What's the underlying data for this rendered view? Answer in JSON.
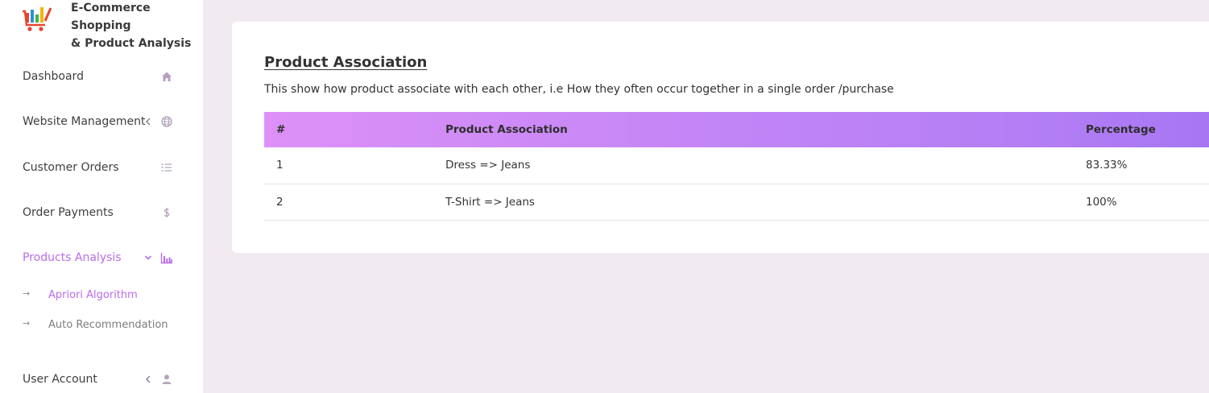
{
  "app": {
    "title": "E-Commerce Shopping\n& Product Analysis",
    "accent_color": "#b96bea"
  },
  "sidebar": {
    "items": [
      {
        "label": "Dashboard",
        "icon": "home-icon",
        "chevron": ""
      },
      {
        "label": "Website Management",
        "icon": "globe-icon",
        "chevron": "left"
      },
      {
        "label": "Customer Orders",
        "icon": "list-icon",
        "chevron": ""
      },
      {
        "label": "Order Payments",
        "icon": "dollar-icon",
        "chevron": ""
      },
      {
        "label": "Products Analysis",
        "icon": "bar-chart-icon",
        "chevron": "down",
        "active": true
      },
      {
        "label": "User Account",
        "icon": "user-icon",
        "chevron": "left"
      }
    ],
    "sub_items": [
      {
        "label": "Apriori Algorithm",
        "active": true
      },
      {
        "label": "Auto Recommendation",
        "active": false
      }
    ]
  },
  "card": {
    "title": "Product Association",
    "description": "This show how product associate with each other, i.e How they often occur together in a single order /purchase"
  },
  "table": {
    "headers": [
      "#",
      "Product Association",
      "Percentage"
    ],
    "rows": [
      [
        "1",
        "Dress => Jeans",
        "83.33%"
      ],
      [
        "2",
        "T-Shirt => Jeans",
        "100%"
      ]
    ]
  }
}
